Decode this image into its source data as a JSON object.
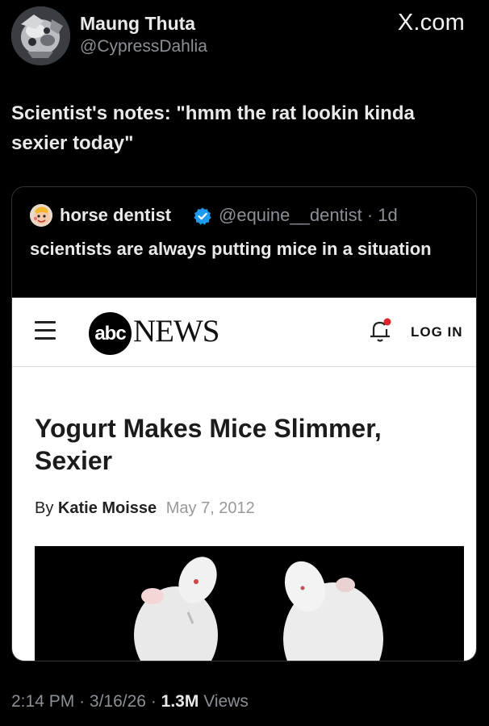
{
  "tweet": {
    "display_name": "Maung Thuta",
    "handle": "@CypressDahlia",
    "source_brand": "X.com",
    "text": "Scientist's notes: \"hmm the rat lookin kinda sexier today\"",
    "avatar_icon": "robot-face-avatar"
  },
  "quoted_tweet": {
    "display_name": "horse dentist",
    "verified": true,
    "handle": "@equine__dentist",
    "age": "· 1d",
    "text": "scientists are always putting mice in a situation",
    "avatar_icon": "cartoon-face-avatar"
  },
  "news_screenshot": {
    "logo_text": "abc",
    "logo_word": "NEWS",
    "login_label": "LOG IN",
    "headline": "Yogurt Makes Mice Slimmer, Sexier",
    "byline_prefix": "By",
    "author": "Katie Moisse",
    "date": "May 7, 2012",
    "notification_dot_color": "#e0242b"
  },
  "footer": {
    "time": "2:14 PM",
    "date": "3/16/26",
    "views": "1.3M",
    "views_label": "Views"
  },
  "colors": {
    "background": "#000000",
    "text_primary": "#e7e9ea",
    "text_secondary": "#8b9096",
    "verified_blue": "#1d9bf0"
  }
}
